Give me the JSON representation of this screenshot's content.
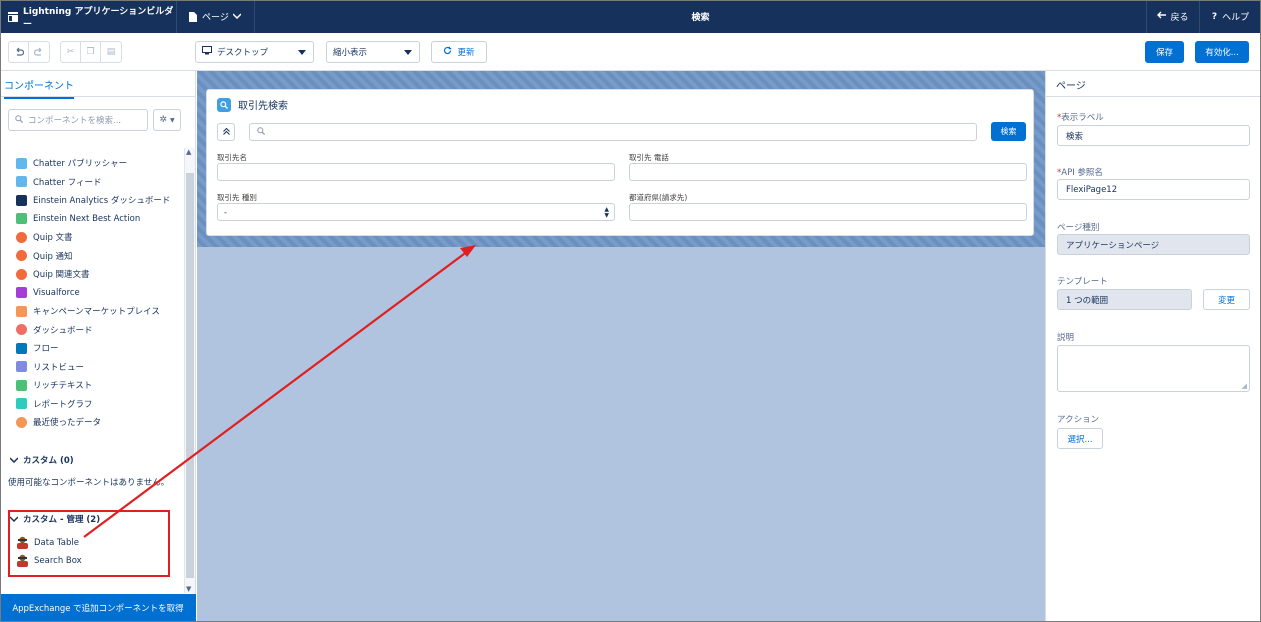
{
  "topbar": {
    "app_title": "Lightning アプリケーションビルダー",
    "pages_label": "ページ",
    "page_name": "検索",
    "back_label": "戻る",
    "help_label": "ヘルプ"
  },
  "toolbar": {
    "device_select": "デスクトップ",
    "zoom_select": "縮小表示",
    "refresh_label": "更新",
    "save_label": "保存",
    "activate_label": "有効化..."
  },
  "left_panel": {
    "tab_label": "コンポーネント",
    "search_placeholder": "コンポーネントを検索...",
    "components": [
      {
        "label": "Chatter パブリッシャー",
        "icon": "lightning-icon",
        "color": "#62b7ed"
      },
      {
        "label": "Chatter フィード",
        "icon": "feed-icon",
        "color": "#62b7ed"
      },
      {
        "label": "Einstein Analytics ダッシュボード",
        "icon": "analytics-icon",
        "color": "#16325c"
      },
      {
        "label": "Einstein Next Best Action",
        "icon": "einstein-icon",
        "color": "#4bc076"
      },
      {
        "label": "Quip 文書",
        "icon": "quip-icon",
        "color": "#f26b3a"
      },
      {
        "label": "Quip 通知",
        "icon": "quip-icon",
        "color": "#f26b3a"
      },
      {
        "label": "Quip 関連文書",
        "icon": "quip-icon",
        "color": "#f26b3a"
      },
      {
        "label": "Visualforce",
        "icon": "code-icon",
        "color": "#a53ed7"
      },
      {
        "label": "キャンペーンマーケットプレイス",
        "icon": "campaign-icon",
        "color": "#f49756"
      },
      {
        "label": "ダッシュボード",
        "icon": "dashboard-icon",
        "color": "#ef6e64"
      },
      {
        "label": "フロー",
        "icon": "flow-icon",
        "color": "#0079bc"
      },
      {
        "label": "リストビュー",
        "icon": "listview-icon",
        "color": "#7f8de1"
      },
      {
        "label": "リッチテキスト",
        "icon": "richtext-icon",
        "color": "#4bc076"
      },
      {
        "label": "レポートグラフ",
        "icon": "report-chart-icon",
        "color": "#2ecbbe"
      },
      {
        "label": "最近使ったデータ",
        "icon": "recent-icon",
        "color": "#f49756"
      }
    ],
    "custom_section": "カスタム (0)",
    "no_components": "使用可能なコンポーネントはありません。",
    "managed_section": "カスタム - 管理 (2)",
    "managed_items": [
      "Data Table",
      "Search Box"
    ],
    "appexchange_label": "AppExchange で追加コンポーネントを取得"
  },
  "canvas": {
    "card_title": "取引先検索",
    "search_button": "検索",
    "fields": [
      {
        "label": "取引先名",
        "value": ""
      },
      {
        "label": "取引先 電話",
        "value": ""
      },
      {
        "label": "取引先 種別",
        "value": "-"
      },
      {
        "label": "都道府県(請求先)",
        "value": ""
      }
    ]
  },
  "right_panel": {
    "header": "ページ",
    "label_field": {
      "label": "表示ラベル",
      "value": "検索"
    },
    "api_field": {
      "label": "API 参照名",
      "value": "FlexiPage12"
    },
    "page_type": {
      "label": "ページ種別",
      "value": "アプリケーションページ"
    },
    "template": {
      "label": "テンプレート",
      "value": "1 つの範囲",
      "change_label": "変更"
    },
    "description": {
      "label": "説明",
      "value": ""
    },
    "actions": {
      "label": "アクション",
      "select_label": "選択..."
    }
  },
  "colors": {
    "brand": "#0070d2",
    "navy": "#16325c",
    "annotation": "#e02020"
  }
}
